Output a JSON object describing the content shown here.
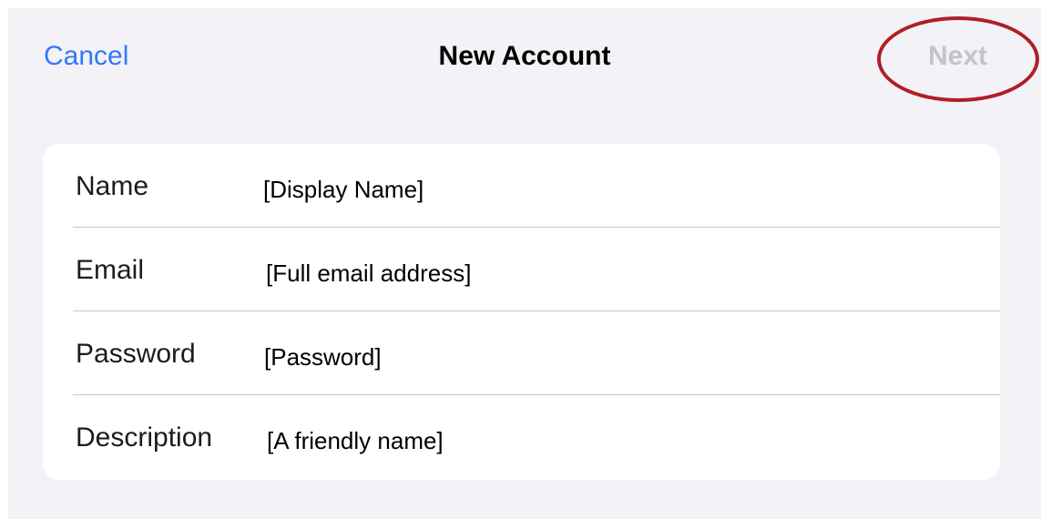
{
  "nav": {
    "cancel_label": "Cancel",
    "title": "New Account",
    "next_label": "Next",
    "colors": {
      "accent": "#3478f6",
      "disabled": "#c4c4c6",
      "highlight": "#b01e24"
    }
  },
  "form": {
    "rows": [
      {
        "label": "Name",
        "placeholder": "[Display Name]"
      },
      {
        "label": "Email",
        "placeholder": "[Full email address]"
      },
      {
        "label": "Password",
        "placeholder": "[Password]"
      },
      {
        "label": "Description",
        "placeholder": "[A friendly name]"
      }
    ]
  }
}
